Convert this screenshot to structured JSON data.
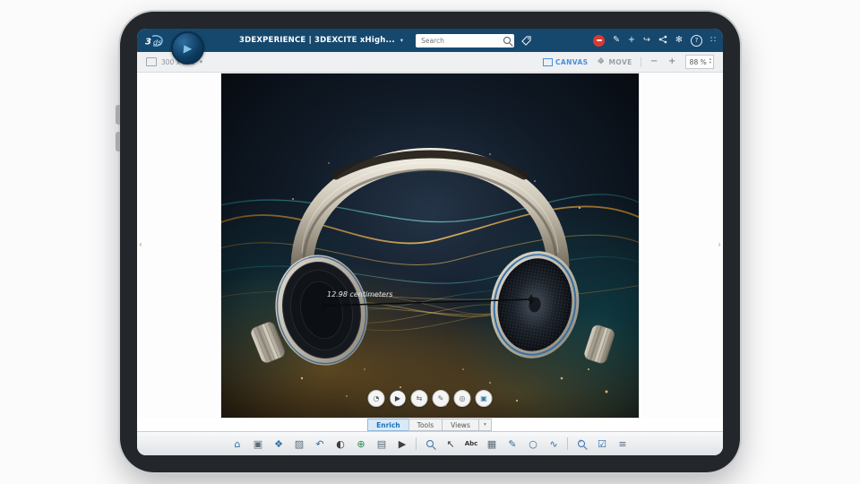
{
  "topbar": {
    "brand_3": "3",
    "brand_ds": "ds",
    "title": "3DEXPERIENCE | 3DEXCITE xHigh...",
    "search_placeholder": "Search",
    "actions": {
      "pen": "✎",
      "add": "+",
      "forward": "↪",
      "magic": "✻",
      "help": "?",
      "apps": "∷"
    },
    "app_badge_glyph": "▶"
  },
  "canvas_toolbar": {
    "size": "300 x 200",
    "canvas_label": "CANVAS",
    "move_label": "MOVE",
    "zoom_minus": "−",
    "zoom_plus": "+",
    "zoom_value": "88 %"
  },
  "viewport": {
    "measurement_label": "12.98 centimeters"
  },
  "floating_toolbar": {
    "buttons": [
      {
        "name": "ar-view",
        "glyph": "◔"
      },
      {
        "name": "play",
        "glyph": "▶"
      },
      {
        "name": "swap-arrows",
        "glyph": "⇆"
      },
      {
        "name": "annotate",
        "glyph": "✎"
      },
      {
        "name": "shape",
        "glyph": "◎"
      },
      {
        "name": "material",
        "glyph": "▣"
      }
    ]
  },
  "tabs": [
    {
      "label": "Enrich",
      "active": true
    },
    {
      "label": "Tools",
      "active": false
    },
    {
      "label": "Views",
      "active": false
    }
  ],
  "bottom_toolbar": {
    "icons": [
      {
        "name": "home",
        "glyph": "⌂"
      },
      {
        "name": "save",
        "glyph": "▣"
      },
      {
        "name": "cube",
        "glyph": "❖"
      },
      {
        "name": "export-image",
        "glyph": "▨"
      },
      {
        "name": "undo",
        "glyph": "↶"
      },
      {
        "name": "sphere-render",
        "glyph": "◐"
      },
      {
        "name": "globe",
        "glyph": "⊕"
      },
      {
        "name": "layers",
        "glyph": "▤"
      },
      {
        "name": "media-play",
        "glyph": "▶"
      },
      {
        "name": "zoom-select",
        "glyph": ""
      },
      {
        "name": "pointer",
        "glyph": "↖"
      },
      {
        "name": "text-tool",
        "glyph": "Abc"
      },
      {
        "name": "image-tool",
        "glyph": "▦"
      },
      {
        "name": "pen-tool",
        "glyph": "✎"
      },
      {
        "name": "ellipse-tool",
        "glyph": "○"
      },
      {
        "name": "spline-tool",
        "glyph": "∿"
      },
      {
        "name": "zoom-plus",
        "glyph": ""
      },
      {
        "name": "validate",
        "glyph": "☑"
      },
      {
        "name": "list-view",
        "glyph": "≡"
      }
    ]
  },
  "ui": {
    "caret_down": "▾",
    "left_toggle": "‹",
    "right_toggle": "›",
    "arrow_h": "↔",
    "arrow_v": "↕",
    "step_up": "▴",
    "step_down": "▾"
  },
  "colors": {
    "topbar_blue": "#16486e",
    "accent_blue": "#4a90d9",
    "active_tab_blue": "#1d6fb8",
    "avatar_red": "#d93a31"
  }
}
